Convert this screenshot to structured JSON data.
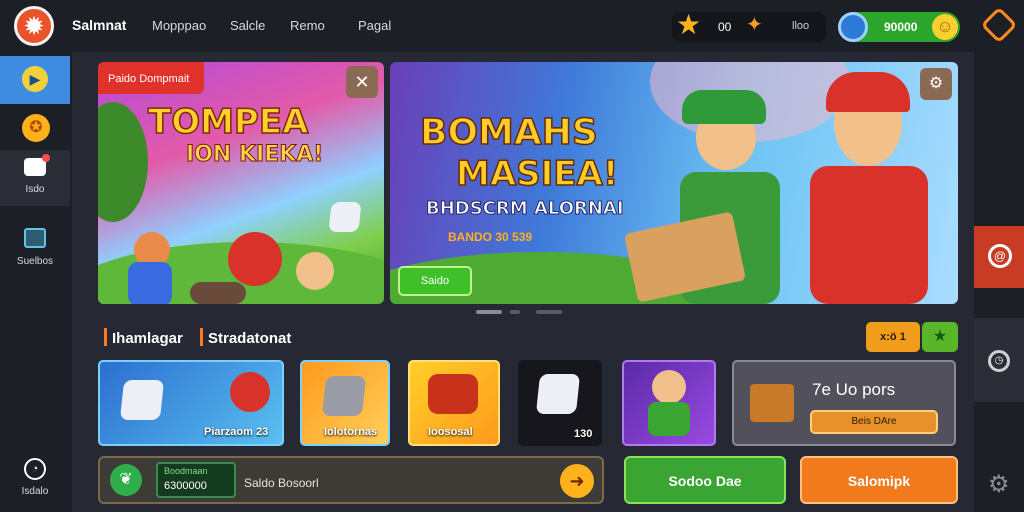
{
  "header": {
    "brand": "Salmnat",
    "nav": [
      "Mopppao",
      "Salcle",
      "Remo",
      "Pagal"
    ],
    "stars": "00",
    "tickets": "lloo",
    "coins": "90000"
  },
  "left_nav": {
    "item3": "Isdo",
    "item4": "Suelbos",
    "item5": "Isdalo"
  },
  "banner1": {
    "tag": "Paido Dompmait",
    "title1": "TOMPEA",
    "title2": "ION KIEKA!"
  },
  "banner2": {
    "title1": "BOMAHS",
    "title2": "MASIEA!",
    "title3": "BHDSCRM ALORNAI",
    "title4": "BANDO 30 539",
    "button": "Saido"
  },
  "section": {
    "left": "Ihamlagar",
    "right": "Stradatonat",
    "ctrl1": "x:ö 1"
  },
  "tiles": [
    {
      "label": "Piarzaom 23"
    },
    {
      "label": "Iolotornas"
    },
    {
      "label": "Ioososal"
    },
    {
      "label": "130"
    },
    {
      "label": ""
    }
  ],
  "promo": {
    "title": "7e Uo pors",
    "button": "Beis DAre"
  },
  "bottom": {
    "small": "Boodmaan",
    "value": "6300000",
    "label": "Saldo Bosoorl"
  },
  "buttons": {
    "green": "Sodoo Dae",
    "orange": "Salomipk"
  },
  "colors": {
    "accent": "#ff7a1c",
    "green": "#3aa532",
    "blue": "#3e8de0"
  }
}
